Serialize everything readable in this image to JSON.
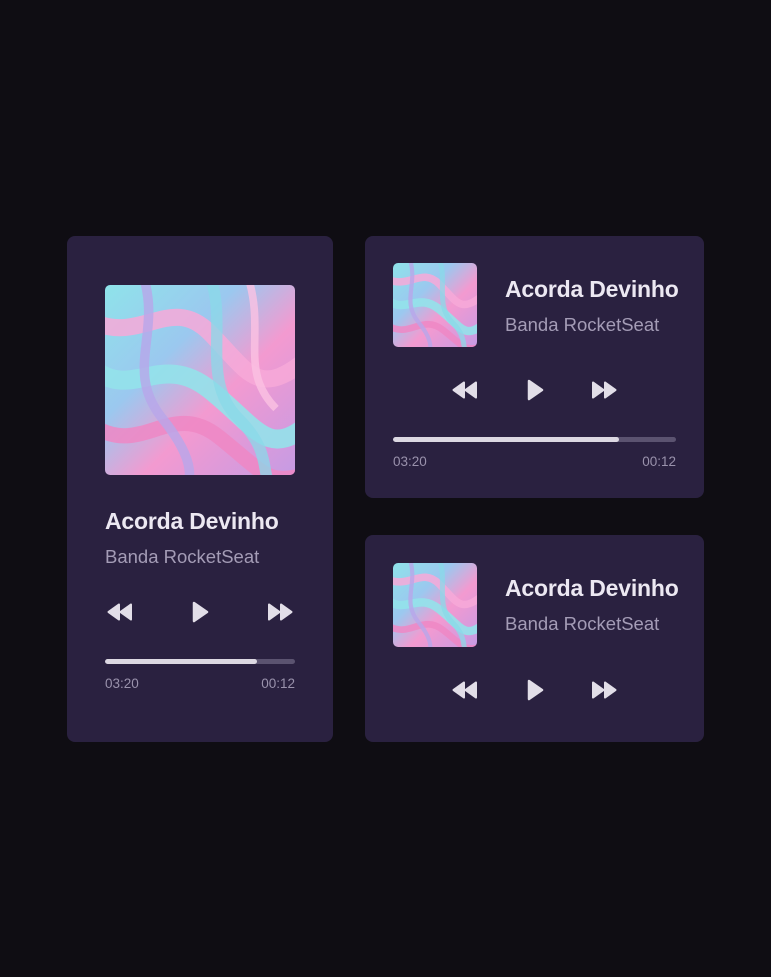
{
  "players": [
    {
      "variant": "large",
      "title": "Acorda Devinho",
      "artist": "Banda RocketSeat",
      "progress": 0.8,
      "time_elapsed": "03:20",
      "time_remaining": "00:12",
      "cover": "abstract-marble-cover"
    },
    {
      "variant": "compact",
      "title": "Acorda Devinho",
      "artist": "Banda RocketSeat",
      "progress": 0.8,
      "time_elapsed": "03:20",
      "time_remaining": "00:12",
      "cover": "abstract-marble-cover"
    },
    {
      "variant": "mini",
      "title": "Acorda Devinho",
      "artist": "Banda RocketSeat",
      "cover": "abstract-marble-cover"
    }
  ],
  "icons": {
    "previous": "rewind-icon",
    "play": "play-icon",
    "next": "fast-forward-icon"
  },
  "colors": {
    "background": "#0f0d13",
    "card": "#2a2140",
    "title": "#ece8f2",
    "artist": "#a49cb6",
    "progress_fill": "#dcd8e2",
    "progress_track": "#5b5370",
    "icon": "#e2dee8"
  }
}
